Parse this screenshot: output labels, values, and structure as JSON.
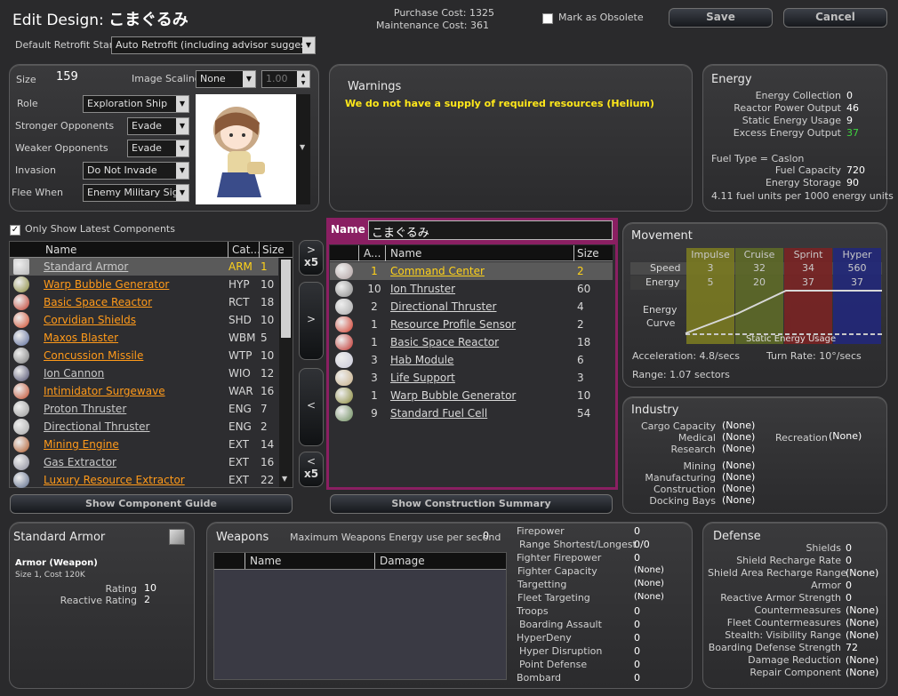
{
  "header": {
    "title_prefix": "Edit Design:",
    "design_name": "こまぐるみ",
    "purchase_cost": "Purchase Cost: 1325",
    "maintenance_cost": "Maintenance Cost: 361",
    "obsolete_label": "Mark as Obsolete",
    "save_label": "Save",
    "cancel_label": "Cancel",
    "retrofit_label": "Default Retrofit Stance",
    "retrofit_value": "Auto Retrofit (including advisor suggestions)"
  },
  "design": {
    "size_label": "Size",
    "size_value": "159",
    "image_scaling_label": "Image Scaling",
    "image_scaling_value": "None",
    "image_scaling_number": "1.00",
    "role_label": "Role",
    "role_value": "Exploration Ship",
    "stronger_label": "Stronger Opponents",
    "stronger_value": "Evade",
    "weaker_label": "Weaker Opponents",
    "weaker_value": "Evade",
    "invasion_label": "Invasion",
    "invasion_value": "Do Not Invade",
    "flee_label": "Flee When",
    "flee_value": "Enemy Military Sighted"
  },
  "warnings": {
    "title": "Warnings",
    "message": "We do not have a supply of required resources (Helium)"
  },
  "energy": {
    "title": "Energy",
    "rows": [
      {
        "label": "Energy Collection",
        "value": "0"
      },
      {
        "label": "Reactor Power Output",
        "value": "46"
      },
      {
        "label": "Static Energy Usage",
        "value": "9"
      },
      {
        "label": "Excess Energy Output",
        "value": "37"
      }
    ],
    "fuel_type": "Fuel Type = Caslon",
    "fuel_capacity_label": "Fuel Capacity",
    "fuel_capacity_value": "720",
    "energy_storage_label": "Energy Storage",
    "energy_storage_value": "90",
    "fuel_ratio": "4.11 fuel units per 1000 energy units",
    "excess_color": "#3fd43f"
  },
  "components": {
    "only_latest_label": "Only Show Latest Components",
    "col_name": "Name",
    "col_cat": "Cat...",
    "col_size": "Size",
    "items": [
      {
        "name": "Standard Armor",
        "cat": "ARM",
        "size": "1",
        "color": "#c8c8c8"
      },
      {
        "name": "Warp Bubble Generator",
        "cat": "HYP",
        "size": "10",
        "color": "#ff9a1a"
      },
      {
        "name": "Basic Space Reactor",
        "cat": "RCT",
        "size": "18",
        "color": "#ff9a1a"
      },
      {
        "name": "Corvidian Shields",
        "cat": "SHD",
        "size": "10",
        "color": "#ff9a1a"
      },
      {
        "name": "Maxos Blaster",
        "cat": "WBM",
        "size": "5",
        "color": "#ff9a1a"
      },
      {
        "name": "Concussion Missile",
        "cat": "WTP",
        "size": "10",
        "color": "#ff9a1a"
      },
      {
        "name": "Ion Cannon",
        "cat": "WIO",
        "size": "12",
        "color": "#c8c8c8"
      },
      {
        "name": "Intimidator Surgewave",
        "cat": "WAR",
        "size": "16",
        "color": "#ff9a1a"
      },
      {
        "name": "Proton Thruster",
        "cat": "ENG",
        "size": "7",
        "color": "#c8c8c8"
      },
      {
        "name": "Directional Thruster",
        "cat": "ENG",
        "size": "2",
        "color": "#c8c8c8"
      },
      {
        "name": "Mining Engine",
        "cat": "EXT",
        "size": "14",
        "color": "#ff9a1a"
      },
      {
        "name": "Gas Extractor",
        "cat": "EXT",
        "size": "16",
        "color": "#c8c8c8"
      },
      {
        "name": "Luxury Resource Extractor",
        "cat": "EXT",
        "size": "22",
        "color": "#ff9a1a"
      }
    ],
    "show_guide_label": "Show Component Guide"
  },
  "transfer": {
    "add_x5": "x5",
    "add": ">",
    "remove": "<",
    "remove_x5": "x5"
  },
  "construction": {
    "name_label": "Name",
    "name_value": "こまぐるみ",
    "col_amount": "A...",
    "col_name": "Name",
    "col_size": "Size",
    "items": [
      {
        "amount": "1",
        "name": "Command Center",
        "size": "2"
      },
      {
        "amount": "10",
        "name": "Ion Thruster",
        "size": "60"
      },
      {
        "amount": "2",
        "name": "Directional Thruster",
        "size": "4"
      },
      {
        "amount": "1",
        "name": "Resource Profile Sensor",
        "size": "2"
      },
      {
        "amount": "1",
        "name": "Basic Space Reactor",
        "size": "18"
      },
      {
        "amount": "3",
        "name": "Hab Module",
        "size": "6"
      },
      {
        "amount": "3",
        "name": "Life Support",
        "size": "3"
      },
      {
        "amount": "1",
        "name": "Warp Bubble Generator",
        "size": "10"
      },
      {
        "amount": "9",
        "name": "Standard Fuel Cell",
        "size": "54"
      }
    ],
    "show_summary_label": "Show Construction Summary",
    "border_color": "#8a1f62"
  },
  "movement": {
    "title": "Movement",
    "cols": [
      "Impulse",
      "Cruise",
      "Sprint",
      "Hyper"
    ],
    "speed_label": "Speed",
    "speed": [
      "3",
      "32",
      "34",
      "560"
    ],
    "energy_label": "Energy",
    "energy": [
      "5",
      "20",
      "37",
      "37"
    ],
    "curve_label_1": "Energy",
    "curve_label_2": "Curve",
    "static_label": "Static Energy Usage",
    "acceleration": "Acceleration: 4.8/secs",
    "turn_rate": "Turn Rate: 10°/secs",
    "range": "Range: 1.07 sectors",
    "col_colors": [
      "#7a7a22",
      "#5e6a28",
      "#7a2424",
      "#22287a"
    ]
  },
  "industry": {
    "title": "Industry",
    "left": [
      {
        "label": "Cargo Capacity",
        "value": "(None)"
      },
      {
        "label": "Medical",
        "value": "(None)"
      },
      {
        "label": "Research",
        "value": "(None)"
      }
    ],
    "recreation_label": "Recreation",
    "recreation_value": "(None)",
    "left2": [
      {
        "label": "Mining",
        "value": "(None)"
      },
      {
        "label": "Manufacturing",
        "value": "(None)"
      },
      {
        "label": "Construction",
        "value": "(None)"
      },
      {
        "label": "Docking Bays",
        "value": "(None)"
      }
    ]
  },
  "selected_component": {
    "title": "Standard Armor",
    "subtitle": "Armor (Weapon)",
    "size_cost": "Size 1, Cost 120K",
    "rating_label": "Rating",
    "rating_value": "10",
    "reactive_label": "Reactive Rating",
    "reactive_value": "2"
  },
  "weapons": {
    "title": "Weapons",
    "max_energy_label": "Maximum Weapons Energy use per second",
    "max_energy_value": "0",
    "col_name": "Name",
    "col_damage": "Damage",
    "stats": [
      {
        "label": "Firepower",
        "value": "0"
      },
      {
        "label": "Range Shortest/Longest",
        "value": "0/0"
      },
      {
        "label": "Fighter Firepower",
        "value": "0"
      },
      {
        "label": "Fighter Capacity",
        "value": "(None)"
      },
      {
        "label": "Targetting",
        "value": "(None)"
      },
      {
        "label": "Fleet Targeting",
        "value": "(None)"
      },
      {
        "label": "Troops",
        "value": "0"
      },
      {
        "label": "Boarding Assault",
        "value": "0"
      },
      {
        "label": "HyperDeny",
        "value": "0"
      },
      {
        "label": "Hyper Disruption",
        "value": "0"
      },
      {
        "label": "Point Defense",
        "value": "0"
      },
      {
        "label": "Bombard",
        "value": "0"
      }
    ]
  },
  "defense": {
    "title": "Defense",
    "rows": [
      {
        "label": "Shields",
        "value": "0"
      },
      {
        "label": "Shield Recharge Rate",
        "value": "0"
      },
      {
        "label": "Shield Area Recharge Range",
        "value": "(None)"
      },
      {
        "label": "Armor",
        "value": "0"
      },
      {
        "label": "Reactive Armor Strength",
        "value": "0"
      },
      {
        "label": "Countermeasures",
        "value": "(None)"
      },
      {
        "label": "Fleet Countermeasures",
        "value": "(None)"
      },
      {
        "label": "Stealth: Visibility Range",
        "value": "(None)"
      },
      {
        "label": "Boarding Defense Strength",
        "value": "72"
      },
      {
        "label": "Damage Reduction",
        "value": "(None)"
      },
      {
        "label": "Repair Component",
        "value": "(None)"
      }
    ]
  }
}
